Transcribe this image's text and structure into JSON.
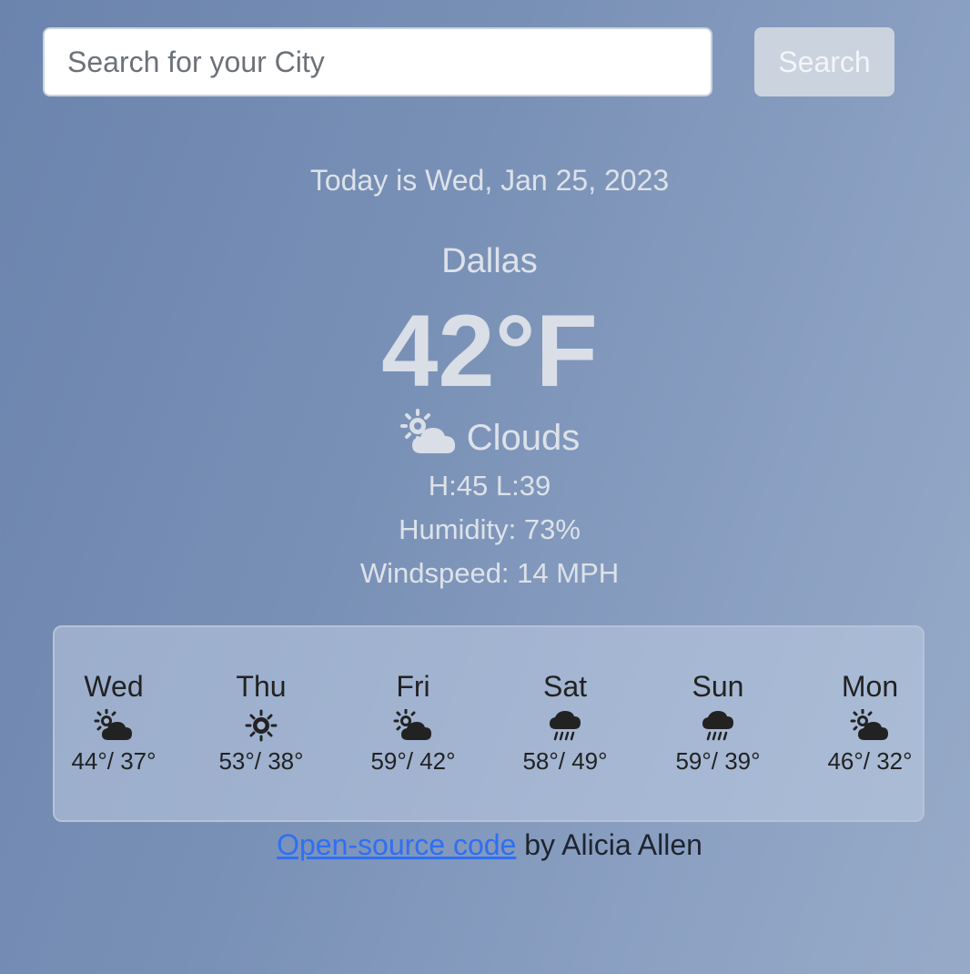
{
  "search": {
    "placeholder": "Search for your City",
    "value": "",
    "button_label": "Search"
  },
  "current": {
    "date_text": "Today is Wed, Jan 25, 2023",
    "city": "Dallas",
    "temperature": "42°F",
    "condition": "Clouds",
    "condition_icon": "sun-cloud-icon",
    "high_low": "H:45 L:39",
    "humidity": "Humidity: 73%",
    "windspeed": "Windspeed: 14 MPH"
  },
  "forecast": [
    {
      "day": "Wed",
      "icon": "sun-cloud-icon",
      "temps": "44°/ 37°"
    },
    {
      "day": "Thu",
      "icon": "sun-icon",
      "temps": "53°/ 38°"
    },
    {
      "day": "Fri",
      "icon": "sun-cloud-icon",
      "temps": "59°/ 42°"
    },
    {
      "day": "Sat",
      "icon": "rain-cloud-icon",
      "temps": "58°/ 49°"
    },
    {
      "day": "Sun",
      "icon": "rain-cloud-icon",
      "temps": "59°/ 39°"
    },
    {
      "day": "Mon",
      "icon": "sun-cloud-icon",
      "temps": "46°/ 32°"
    }
  ],
  "footer": {
    "link_text": "Open-source code",
    "suffix": " by Alicia Allen"
  },
  "colors": {
    "background_start": "#6b84ad",
    "background_end": "#97aac8",
    "link": "#2f6ff2",
    "button": "#cbd3de"
  }
}
